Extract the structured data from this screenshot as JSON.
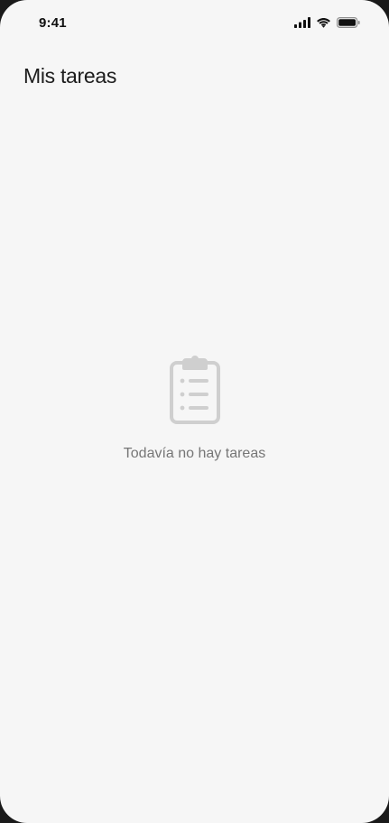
{
  "status_bar": {
    "time": "9:41",
    "icons": [
      "signal-icon",
      "wifi-icon",
      "battery-icon"
    ]
  },
  "header": {
    "title": "Mis tareas"
  },
  "empty_state": {
    "icon": "clipboard-icon",
    "message": "Todavía no hay tareas"
  },
  "colors": {
    "background": "#f6f6f6",
    "title": "#1c1c1c",
    "muted_text": "#767676",
    "icon": "#cfcfcf"
  }
}
